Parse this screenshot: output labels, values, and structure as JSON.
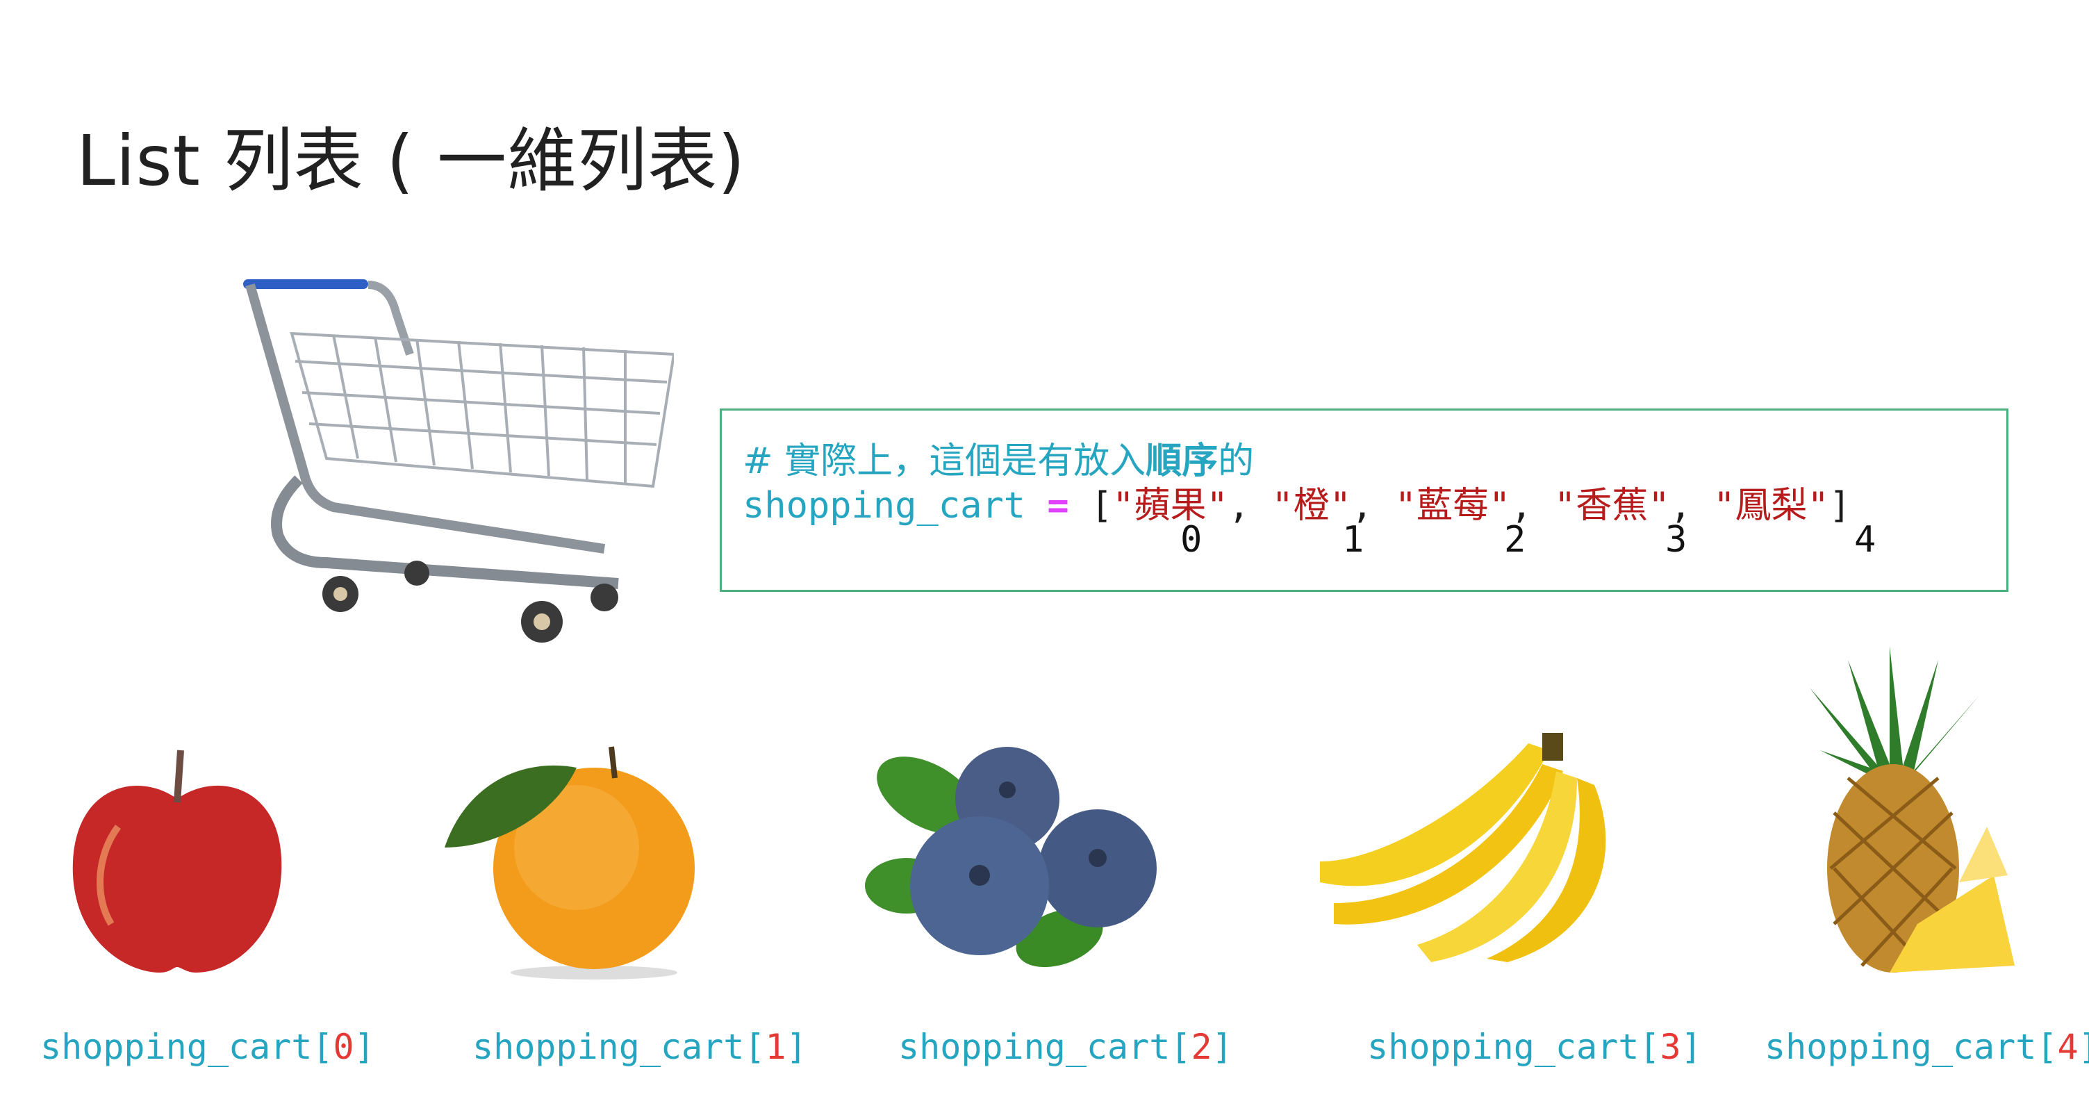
{
  "title": "List 列表 ( 一維列表)",
  "code": {
    "comment_prefix": "# 實際上，這個是有放入",
    "comment_bold": "順序",
    "comment_suffix": "的",
    "var": "shopping_cart",
    "op": "=",
    "open": "[",
    "items": [
      "\"蘋果\"",
      "\"橙\"",
      "\"藍莓\"",
      "\"香蕉\"",
      "\"鳳梨\""
    ],
    "sep": ",",
    "close": "]",
    "indices": [
      "0",
      "1",
      "2",
      "3",
      "4"
    ]
  },
  "labels": [
    {
      "name": "shopping_cart[",
      "idx": "0",
      "end": "]"
    },
    {
      "name": "shopping_cart[",
      "idx": "1",
      "end": "]"
    },
    {
      "name": "shopping_cart[",
      "idx": "2",
      "end": "]"
    },
    {
      "name": "shopping_cart[",
      "idx": "3",
      "end": "]"
    },
    {
      "name": "shopping_cart[",
      "idx": "4",
      "end": "]"
    }
  ],
  "icons": [
    "shopping-cart-icon",
    "apple-icon",
    "orange-icon",
    "blueberry-icon",
    "banana-icon",
    "pineapple-icon"
  ],
  "colors": {
    "code_cyan": "#26a5c0",
    "string_red": "#b71c1c",
    "index_red": "#e53935",
    "box_border": "#4caf80",
    "operator": "#e040fb"
  }
}
